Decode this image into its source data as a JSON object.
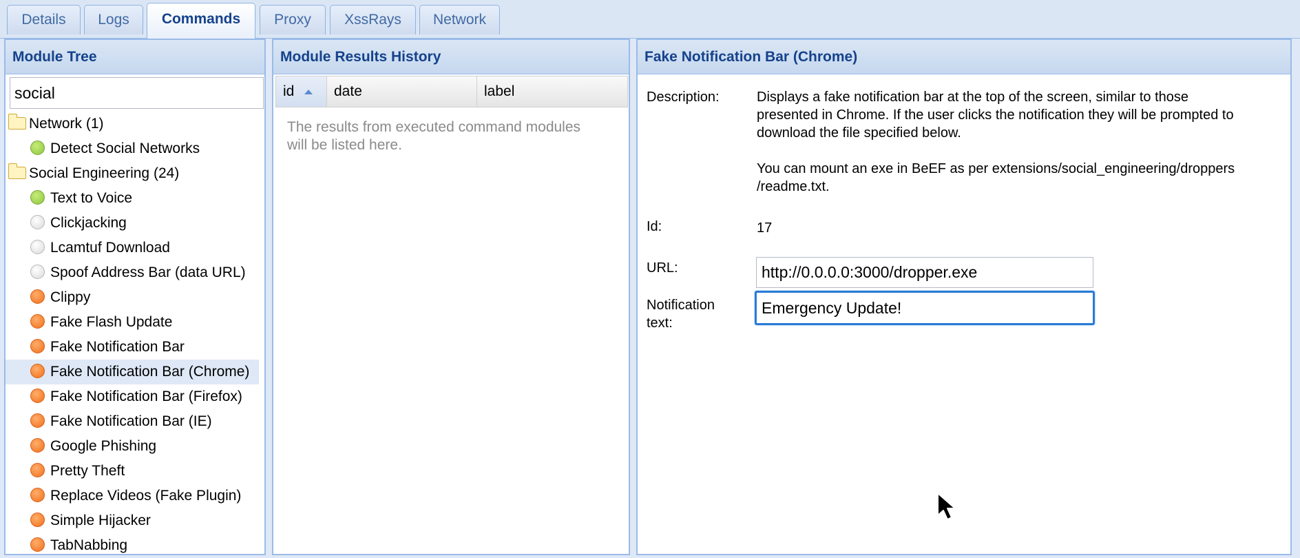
{
  "tabs": [
    "Details",
    "Logs",
    "Commands",
    "Proxy",
    "XssRays",
    "Network"
  ],
  "active_tab": "Commands",
  "module_tree": {
    "title": "Module Tree",
    "search_value": "social",
    "items": [
      {
        "type": "group",
        "label": "Network (1)"
      },
      {
        "type": "leaf",
        "status": "green",
        "label": "Detect Social Networks"
      },
      {
        "type": "group",
        "label": "Social Engineering (24)"
      },
      {
        "type": "leaf",
        "status": "green",
        "label": "Text to Voice"
      },
      {
        "type": "leaf",
        "status": "grey",
        "label": "Clickjacking"
      },
      {
        "type": "leaf",
        "status": "grey",
        "label": "Lcamtuf Download"
      },
      {
        "type": "leaf",
        "status": "grey",
        "label": "Spoof Address Bar (data URL)"
      },
      {
        "type": "leaf",
        "status": "orange",
        "label": "Clippy"
      },
      {
        "type": "leaf",
        "status": "orange",
        "label": "Fake Flash Update"
      },
      {
        "type": "leaf",
        "status": "orange",
        "label": "Fake Notification Bar"
      },
      {
        "type": "leaf",
        "status": "orange",
        "label": "Fake Notification Bar (Chrome)",
        "selected": true
      },
      {
        "type": "leaf",
        "status": "orange",
        "label": "Fake Notification Bar (Firefox)"
      },
      {
        "type": "leaf",
        "status": "orange",
        "label": "Fake Notification Bar (IE)"
      },
      {
        "type": "leaf",
        "status": "orange",
        "label": "Google Phishing"
      },
      {
        "type": "leaf",
        "status": "orange",
        "label": "Pretty Theft"
      },
      {
        "type": "leaf",
        "status": "orange",
        "label": "Replace Videos (Fake Plugin)"
      },
      {
        "type": "leaf",
        "status": "orange",
        "label": "Simple Hijacker"
      },
      {
        "type": "leaf",
        "status": "orange",
        "label": "TabNabbing"
      }
    ]
  },
  "results_history": {
    "title": "Module Results History",
    "columns": [
      "id",
      "date",
      "label"
    ],
    "sort_column": "id",
    "sort_direction": "ascending",
    "empty_message": "The results from executed command modules will be listed here."
  },
  "module_detail": {
    "title": "Fake Notification Bar (Chrome)",
    "description_label": "Description:",
    "description_line1": "Displays a fake notification bar at the top of the screen, similar to those",
    "description_line2": "presented in Chrome. If the user clicks the notification they will be prompted to",
    "description_line3": "download the file specified below.",
    "description_line4": "You can mount an exe in BeEF as per extensions/social_engineering/droppers",
    "description_line5": "/readme.txt.",
    "id_label": "Id:",
    "id_value": "17",
    "url_label": "URL:",
    "url_value": "http://0.0.0.0:3000/dropper.exe",
    "notification_label_line1": "Notification",
    "notification_label_line2": "text:",
    "notification_value": "Emergency Update!"
  },
  "colors": {
    "header_text": "#15428b",
    "panel_border": "#99bbe8",
    "focus_border": "#2a7bd6",
    "selection": "#dfe8f6"
  },
  "icons": {
    "folder": "folder-icon",
    "status_green": "status-working-icon",
    "status_grey": "status-unknown-icon",
    "status_orange": "status-visible-icon",
    "sort": "sort-ascending-icon",
    "cursor": "mouse-pointer-icon"
  }
}
